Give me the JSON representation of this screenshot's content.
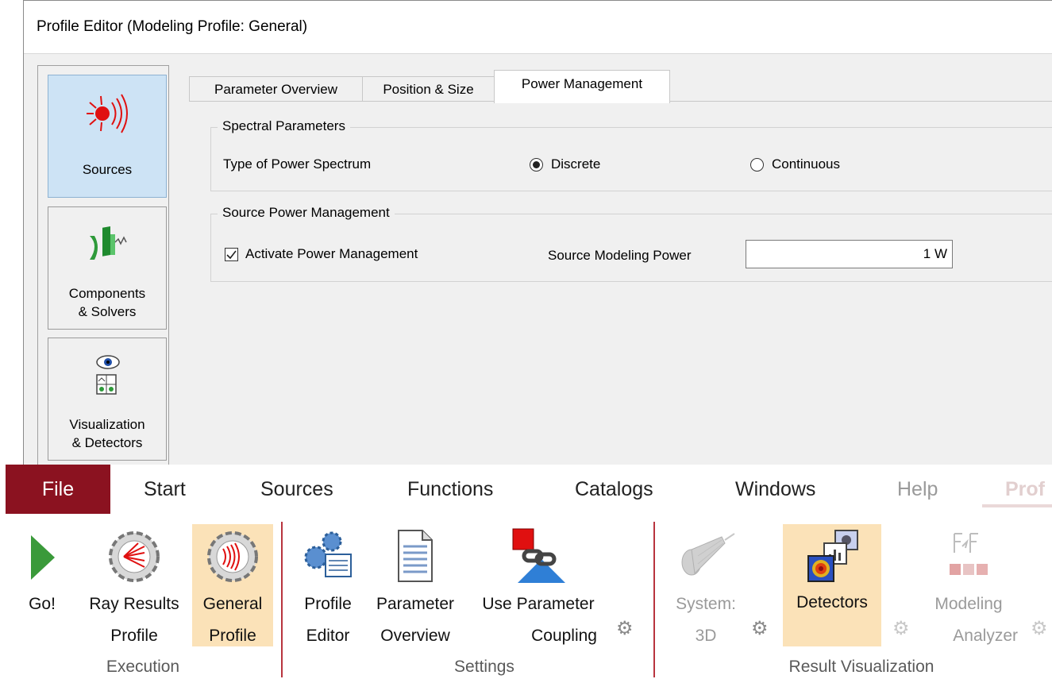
{
  "window": {
    "title": "Profile Editor (Modeling Profile: General)"
  },
  "categories": [
    {
      "icon": "light-source-icon",
      "label_lines": [
        "Sources"
      ],
      "selected": true
    },
    {
      "icon": "components-icon",
      "label_lines": [
        "Components",
        "& Solvers"
      ],
      "selected": false
    },
    {
      "icon": "eye-detector-icon",
      "label_lines": [
        "Visualization",
        "& Detectors"
      ],
      "selected": false
    }
  ],
  "tabs": [
    {
      "label": "Parameter Overview",
      "active": false
    },
    {
      "label": "Position & Size",
      "active": false
    },
    {
      "label": "Power Management",
      "active": true
    }
  ],
  "spectral": {
    "title": "Spectral Parameters",
    "type_label": "Type of Power Spectrum",
    "options": [
      {
        "label": "Discrete",
        "selected": true
      },
      {
        "label": "Continuous",
        "selected": false
      }
    ]
  },
  "power": {
    "title": "Source Power Management",
    "activate_label": "Activate Power Management",
    "activate_checked": true,
    "modeling_power_label": "Source Modeling Power",
    "modeling_power_value": "1 W"
  },
  "menubar": [
    "File",
    "Start",
    "Sources",
    "Functions",
    "Catalogs",
    "Windows",
    "Help",
    "Prof"
  ],
  "ribbon": {
    "execution": {
      "label": "Execution",
      "buttons": [
        {
          "label_lines": [
            "Go!"
          ],
          "icon": "go-play-icon"
        },
        {
          "label_lines": [
            "Ray Results",
            "Profile"
          ],
          "icon": "ray-results-profile-icon"
        },
        {
          "label_lines": [
            "General",
            "Profile"
          ],
          "icon": "general-profile-icon",
          "highlighted": true
        }
      ]
    },
    "settings": {
      "label": "Settings",
      "buttons": [
        {
          "label_lines": [
            "Profile",
            "Editor"
          ],
          "icon": "profile-editor-icon"
        },
        {
          "label_lines": [
            "Parameter",
            "Overview"
          ],
          "icon": "parameter-overview-icon"
        },
        {
          "label_lines": [
            "Use Parameter",
            "Coupling"
          ],
          "icon": "parameter-coupling-icon"
        }
      ]
    },
    "result_visualization": {
      "label": "Result Visualization",
      "buttons": [
        {
          "label_lines": [
            "System:",
            "3D"
          ],
          "icon": "system-3d-icon",
          "disabled": true
        },
        {
          "label_lines": [
            "Detectors"
          ],
          "icon": "detectors-icon",
          "highlighted": true
        },
        {
          "label_lines": [
            "Modeling",
            "Analyzer"
          ],
          "icon": "modeling-analyzer-icon",
          "disabled": true
        }
      ]
    }
  },
  "colors": {
    "file_menu_bg": "#8b1220",
    "highlight_bg": "#fbe2b8",
    "selected_category_bg": "#cde3f5",
    "group_separator": "#b8343e"
  }
}
